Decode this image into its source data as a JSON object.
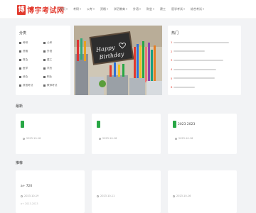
{
  "header": {
    "logo_mark": "博",
    "logo_text": "博宇考试网",
    "nav": [
      {
        "label": "首页",
        "has_caret": true
      },
      {
        "label": "考研",
        "has_caret": true
      },
      {
        "label": "公考",
        "has_caret": true
      },
      {
        "label": "资格",
        "has_caret": true
      },
      {
        "label": "学历教育",
        "has_caret": true
      },
      {
        "label": "外语",
        "has_caret": true
      },
      {
        "label": "财会",
        "has_caret": true
      },
      {
        "label": "建工",
        "has_caret": false
      },
      {
        "label": "医学考试",
        "has_caret": true
      },
      {
        "label": "综合考试",
        "has_caret": true
      }
    ]
  },
  "categories": {
    "title": "分类",
    "items": [
      "考研",
      "公考",
      "资格",
      "外语",
      "财会",
      "建工",
      "医学",
      "学历",
      "综合",
      "职业",
      "其他考试",
      "教师考试"
    ]
  },
  "banner": {
    "text_line1": "Happy",
    "text_line2": "Birthday"
  },
  "hot": {
    "title": "热门",
    "items": [
      {
        "num": "1",
        "text": "                                 "
      },
      {
        "num": "2",
        "text": "               400     "
      },
      {
        "num": "3",
        "text": "                              "
      },
      {
        "num": "4",
        "text": "                    2023      "
      },
      {
        "num": "5",
        "text": "                               "
      },
      {
        "num": "6",
        "text": "            1580   "
      }
    ]
  },
  "section_news": {
    "label": "最新"
  },
  "news": [
    {
      "title": "                     ",
      "date": "2023-10-18"
    },
    {
      "title": "                             ",
      "date": "2023-10-18"
    },
    {
      "title": "2023              2023      ",
      "date": "2023-10-18"
    }
  ],
  "section_articles": {
    "label": "推荐"
  },
  "articles": [
    {
      "title": "        a+                 720",
      "date": "2023-10-19",
      "desc": "        a+               2023-2023              "
    },
    {
      "title": "            ",
      "date": "2023-10-11",
      "desc": ""
    },
    {
      "title": "                      ",
      "date": "2023-10-16",
      "desc": ""
    }
  ]
}
